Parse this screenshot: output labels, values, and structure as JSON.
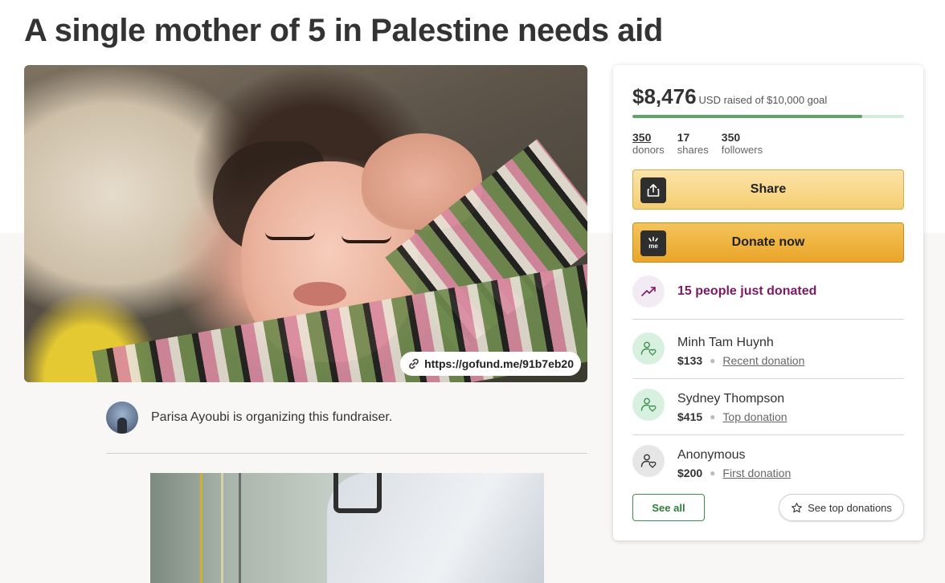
{
  "page_title": "A single mother of 5 in Palestine needs aid",
  "hero": {
    "short_url": "https://gofund.me/91b7eb20"
  },
  "organizer": {
    "text": "Parisa Ayoubi is organizing this fundraiser."
  },
  "donation": {
    "raised": "$8,476",
    "goal_text": "USD raised of $10,000 goal",
    "progress_fraction": 0.8476,
    "stats": [
      {
        "value": "350",
        "label": "donors"
      },
      {
        "value": "17",
        "label": "shares"
      },
      {
        "value": "350",
        "label": "followers"
      }
    ],
    "share_label": "Share",
    "donate_label": "Donate now",
    "recent_activity": "15 people just donated",
    "donors": [
      {
        "name": "Minh Tam Huynh",
        "amount": "$133",
        "kind": "Recent donation",
        "avatar": "green"
      },
      {
        "name": "Sydney Thompson",
        "amount": "$415",
        "kind": "Top donation",
        "avatar": "green"
      },
      {
        "name": "Anonymous",
        "amount": "$200",
        "kind": "First donation",
        "avatar": "gray"
      }
    ],
    "see_all_label": "See all",
    "see_top_label": "See top donations"
  },
  "colors": {
    "progress_fill": "#5fa36a",
    "trend_text": "#7b1a64",
    "share_button": "#f5ce72",
    "donate_button": "#eaa52a"
  },
  "icons": [
    "link-icon",
    "upload-icon",
    "gofundme-logo-icon",
    "trending-up-icon",
    "donor-heart-icon",
    "star-icon"
  ]
}
